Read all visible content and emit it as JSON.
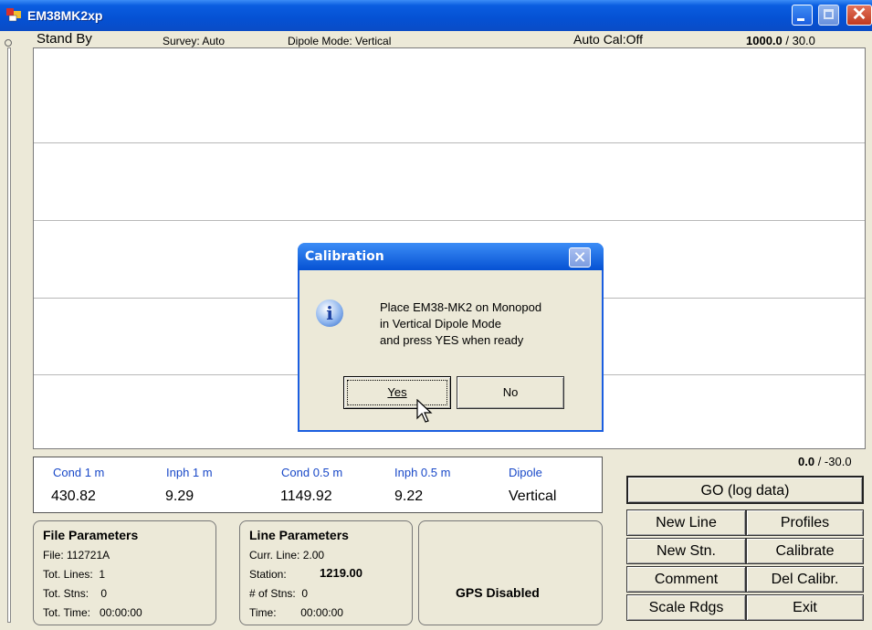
{
  "window": {
    "title": "EM38MK2xp"
  },
  "status": {
    "mode": "Stand By",
    "survey": "Survey: Auto",
    "dipole_mode": "Dipole Mode: Vertical",
    "auto_cal": "Auto Cal:Off",
    "top_scale_bold": "1000.0",
    "top_scale_rest": " / 30.0",
    "bottom_scale_bold": "0.0",
    "bottom_scale_rest": " / -30.0"
  },
  "readings": {
    "labels": [
      "Cond 1 m",
      "Inph 1 m",
      "Cond 0.5 m",
      "Inph 0.5 m",
      "Dipole"
    ],
    "values": [
      "430.82",
      "9.29",
      "1149.92",
      "9.22",
      "Vertical"
    ]
  },
  "buttons": {
    "go": "GO (log data)",
    "new_line": "New Line",
    "profiles": "Profiles",
    "new_stn": "New Stn.",
    "calibrate": "Calibrate",
    "comment": "Comment",
    "del_calibr": "Del Calibr.",
    "scale_rdgs": "Scale Rdgs",
    "exit": "Exit"
  },
  "file_params": {
    "title": "File Parameters",
    "file": "File: 112721A",
    "tot_lines": "Tot. Lines:  1",
    "tot_stns": "Tot. Stns:    0",
    "tot_time": "Tot. Time:   00:00:00"
  },
  "line_params": {
    "title": "Line Parameters",
    "curr_line": "Curr. Line: 2.00",
    "station_label": "Station:",
    "station_value": "1219.00",
    "num_stns": "# of Stns:  0",
    "time": "Time:        00:00:00"
  },
  "gps": {
    "status": "GPS Disabled"
  },
  "dialog": {
    "title": "Calibration",
    "message_lines": [
      "Place EM38-MK2 on Monopod",
      "in Vertical Dipole Mode",
      "and press YES when ready"
    ],
    "yes": "Yes",
    "no": "No",
    "icon": "information-icon"
  },
  "colors": {
    "titlebar": "#0551d3",
    "label_blue": "#1848c8",
    "face": "#ece9d8"
  }
}
